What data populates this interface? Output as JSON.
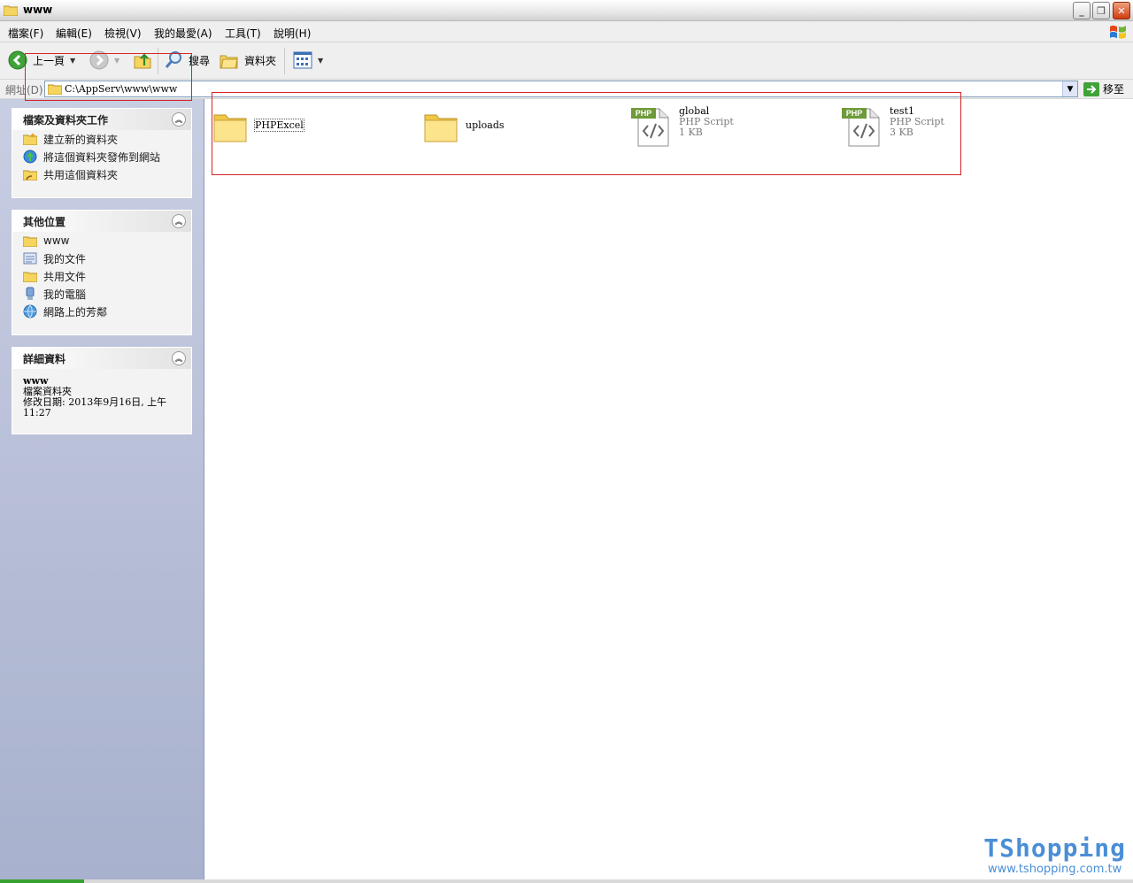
{
  "window": {
    "title": "www"
  },
  "menu": [
    "檔案(F)",
    "編輯(E)",
    "檢視(V)",
    "我的最愛(A)",
    "工具(T)",
    "說明(H)"
  ],
  "toolbar": {
    "back_label": "上一頁",
    "search_label": "搜尋",
    "folders_label": "資料夾"
  },
  "address": {
    "label": "網址(D)",
    "path": "C:\\AppServ\\www\\www",
    "go_label": "移至"
  },
  "sidebar": {
    "tasks": {
      "title": "檔案及資料夾工作",
      "items": [
        "建立新的資料夾",
        "將這個資料夾發佈到網站",
        "共用這個資料夾"
      ]
    },
    "places": {
      "title": "其他位置",
      "items": [
        "www",
        "我的文件",
        "共用文件",
        "我的電腦",
        "網路上的芳鄰"
      ]
    },
    "details": {
      "title": "詳細資料",
      "name": "www",
      "type": "檔案資料夾",
      "modified": "修改日期: 2013年9月16日, 上午 11:27"
    }
  },
  "files": [
    {
      "name": "PHPExcel",
      "kind": "folder"
    },
    {
      "name": "uploads",
      "kind": "folder"
    },
    {
      "name": "global",
      "kind": "php",
      "type": "PHP Script",
      "size": "1 KB"
    },
    {
      "name": "test1",
      "kind": "php",
      "type": "PHP Script",
      "size": "3 KB"
    }
  ],
  "php_badge": "PHP",
  "watermark": {
    "logo": "TShopping",
    "url": "www.tshopping.com.tw"
  },
  "colors": {
    "highlight": "#d62424",
    "sidebar": "#a8b1cd",
    "folder": "#f5d55f",
    "watermark": "#4a8ed6"
  }
}
